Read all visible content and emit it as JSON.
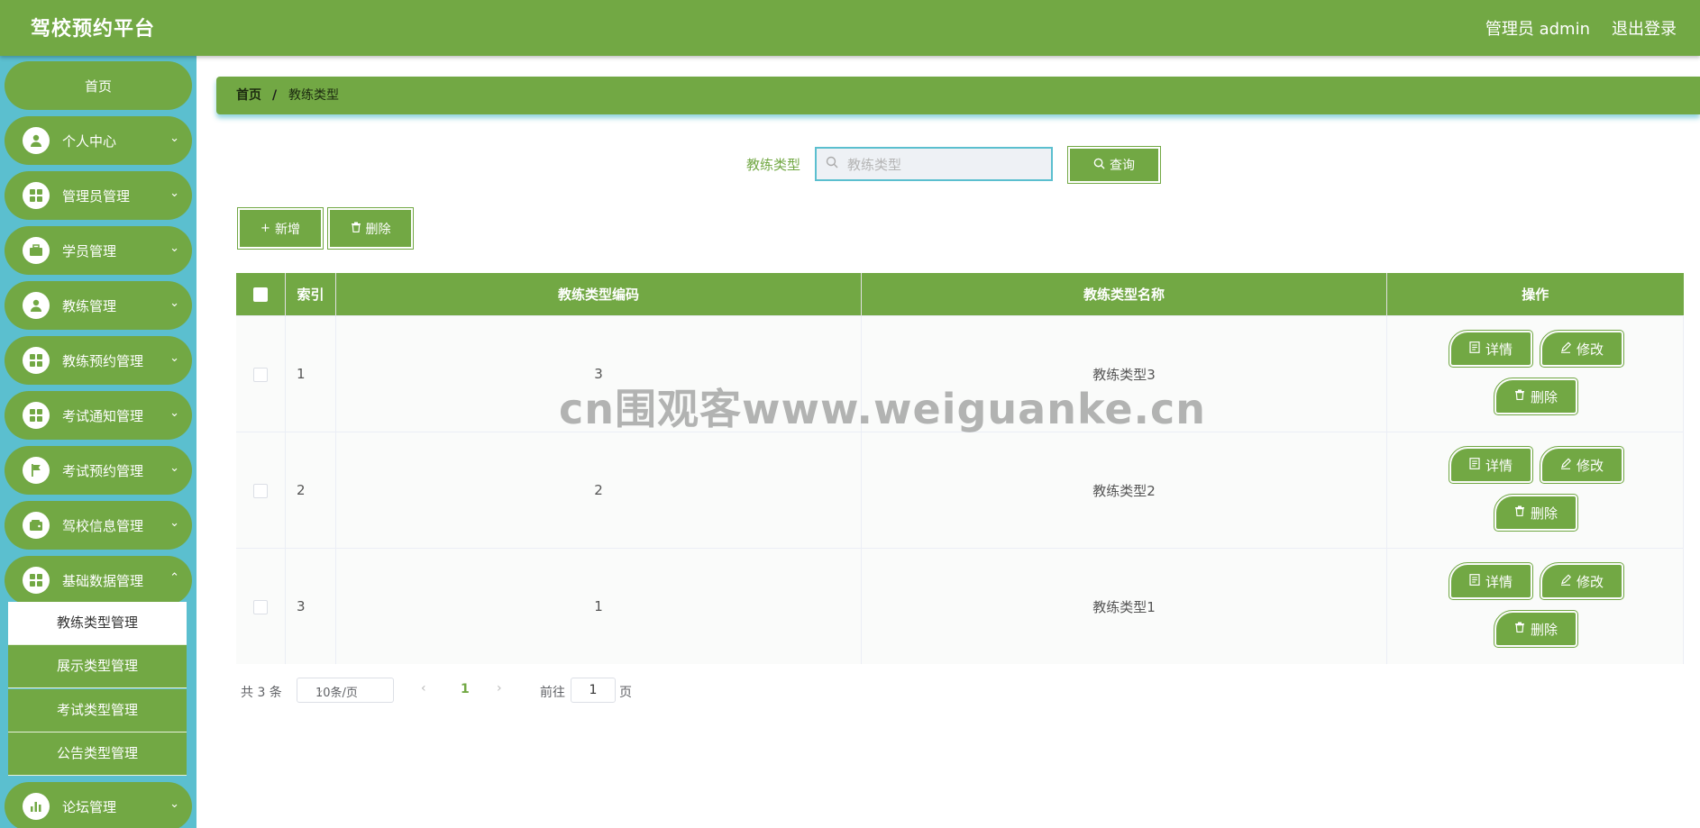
{
  "header": {
    "title": "驾校预约平台",
    "admin": "管理员 admin",
    "logout": "退出登录"
  },
  "sidebar": {
    "home": "首页",
    "items": [
      {
        "label": "个人中心",
        "icon": "user-icon"
      },
      {
        "label": "管理员管理",
        "icon": "grid-icon"
      },
      {
        "label": "学员管理",
        "icon": "briefcase-icon"
      },
      {
        "label": "教练管理",
        "icon": "user-icon"
      },
      {
        "label": "教练预约管理",
        "icon": "grid-icon"
      },
      {
        "label": "考试通知管理",
        "icon": "grid-icon"
      },
      {
        "label": "考试预约管理",
        "icon": "flag-icon"
      },
      {
        "label": "驾校信息管理",
        "icon": "wallet-icon"
      },
      {
        "label": "基础数据管理",
        "icon": "grid-icon"
      }
    ],
    "sub_items": [
      "教练类型管理",
      "展示类型管理",
      "考试类型管理",
      "公告类型管理"
    ],
    "forum": {
      "label": "论坛管理",
      "icon": "bar-chart-icon"
    }
  },
  "breadcrumb": {
    "home": "首页",
    "sep": "/",
    "current": "教练类型"
  },
  "search": {
    "label": "教练类型",
    "placeholder": "教练类型",
    "button": "查询"
  },
  "actions": {
    "add": "新增",
    "delete": "删除"
  },
  "table": {
    "columns": [
      "索引",
      "教练类型编码",
      "教练类型名称",
      "操作"
    ],
    "rows": [
      {
        "index": "1",
        "code": "3",
        "name": "教练类型3"
      },
      {
        "index": "2",
        "code": "2",
        "name": "教练类型2"
      },
      {
        "index": "3",
        "code": "1",
        "name": "教练类型1"
      }
    ],
    "op_labels": {
      "detail": "详情",
      "edit": "修改",
      "delete": "删除"
    }
  },
  "pagination": {
    "total": "共 3 条",
    "page_size": "10条/页",
    "current_page": "1",
    "goto_label": "前往",
    "goto_value": "1",
    "page_suffix": "页"
  },
  "watermark": "cn围观客www.weiguanke.cn",
  "colors": {
    "accent": "#72a844",
    "sidebar": "#5bbfcf"
  }
}
